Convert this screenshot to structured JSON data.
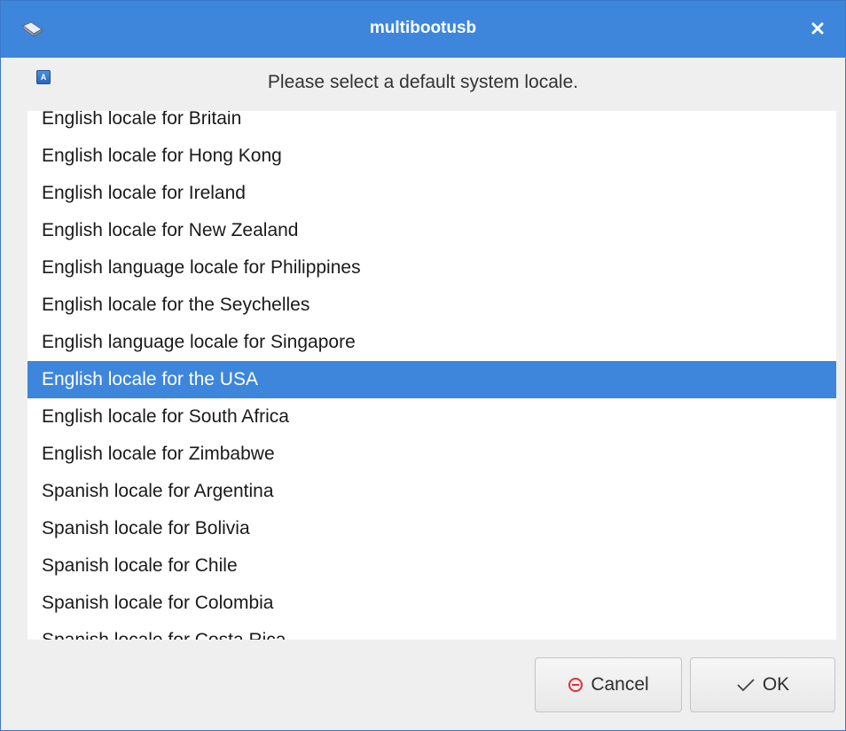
{
  "window": {
    "title": "multibootusb",
    "title_icon": "usb-drive-icon",
    "close_icon": "close-icon"
  },
  "prompt": {
    "icon": "locale-icon",
    "icon_label": "A",
    "text": "Please select a default system locale."
  },
  "locales": {
    "items": [
      "English locale for Britain",
      "English locale for Hong Kong",
      "English locale for Ireland",
      "English locale for New Zealand",
      "English language locale for Philippines",
      "English locale for the Seychelles",
      "English language locale for Singapore",
      "English locale for the USA",
      "English locale for South Africa",
      "English locale for Zimbabwe",
      "Spanish locale for Argentina",
      "Spanish locale for Bolivia",
      "Spanish locale for Chile",
      "Spanish locale for Colombia",
      "Spanish locale for Costa Rica"
    ],
    "selected_index": 7
  },
  "buttons": {
    "cancel_label": "Cancel",
    "cancel_icon": "cancel-icon",
    "ok_label": "OK",
    "ok_icon": "checkmark-icon"
  },
  "colors": {
    "accent": "#3d86db",
    "cancel_icon": "#e0303a"
  }
}
